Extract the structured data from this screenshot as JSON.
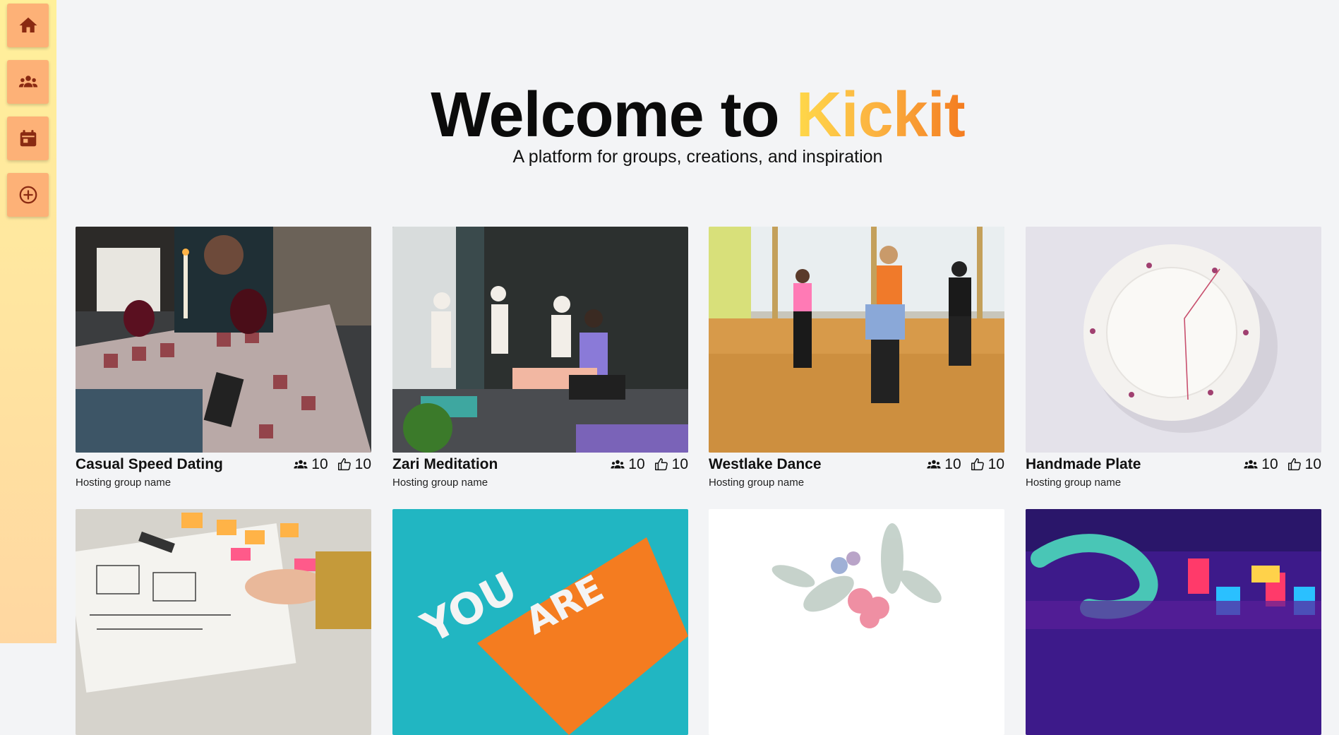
{
  "sidebar": {
    "items": [
      {
        "icon": "home-icon"
      },
      {
        "icon": "groups-icon"
      },
      {
        "icon": "calendar-icon"
      },
      {
        "icon": "add-circle-icon"
      }
    ]
  },
  "hero": {
    "title_prefix": "Welcome to ",
    "title_brand": "Kickit",
    "subtitle": "A platform for groups, creations, and inspiration"
  },
  "colors": {
    "sidebar_button": "#fdb177",
    "brand_gradient": [
      "#ffd84a",
      "#f47c20"
    ],
    "background": "#f3f4f6"
  },
  "cards": [
    {
      "title": "Casual Speed Dating",
      "group": "Hosting group name",
      "members": "10",
      "likes": "10"
    },
    {
      "title": "Zari Meditation",
      "group": "Hosting group name",
      "members": "10",
      "likes": "10"
    },
    {
      "title": "Westlake Dance",
      "group": "Hosting group name",
      "members": "10",
      "likes": "10"
    },
    {
      "title": "Handmade Plate",
      "group": "Hosting group name",
      "members": "10",
      "likes": "10"
    },
    {
      "title": "",
      "group": "",
      "members": "",
      "likes": ""
    },
    {
      "title": "",
      "group": "",
      "members": "",
      "likes": ""
    },
    {
      "title": "",
      "group": "",
      "members": "",
      "likes": ""
    },
    {
      "title": "",
      "group": "",
      "members": "",
      "likes": ""
    }
  ]
}
